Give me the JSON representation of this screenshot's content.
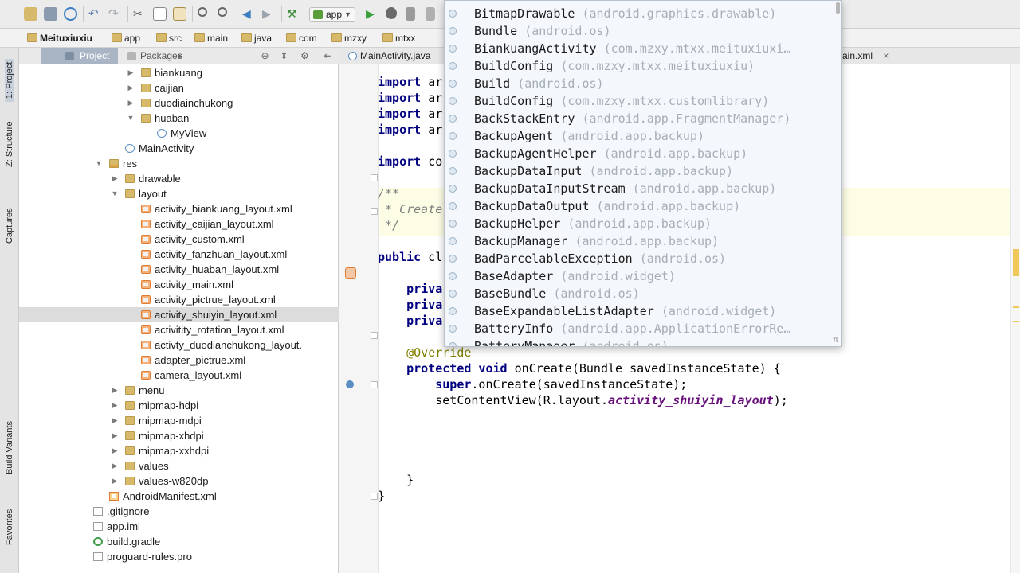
{
  "toolbar": {
    "run_config": "app"
  },
  "breadcrumb": [
    "Meituxiuxiu",
    "app",
    "src",
    "main",
    "java",
    "com",
    "mzxy",
    "mtxx"
  ],
  "left_strip": {
    "tabs": [
      "1: Project",
      "Z: Structure",
      "Captures",
      "Build Variants",
      "Favorites"
    ]
  },
  "project_panel": {
    "tabs": [
      "Project",
      "Packages"
    ],
    "tree": [
      {
        "label": "biankuang",
        "type": "folder",
        "depth": 3,
        "expanded": false
      },
      {
        "label": "caijian",
        "type": "folder",
        "depth": 3,
        "expanded": false
      },
      {
        "label": "duodiainchukong",
        "type": "folder",
        "depth": 3,
        "expanded": false
      },
      {
        "label": "huaban",
        "type": "folder",
        "depth": 3,
        "expanded": true
      },
      {
        "label": "MyView",
        "type": "class",
        "depth": 4
      },
      {
        "label": "MainActivity",
        "type": "class",
        "depth": 2
      },
      {
        "label": "res",
        "type": "res",
        "depth": 1,
        "expanded": true
      },
      {
        "label": "drawable",
        "type": "folder",
        "depth": 2,
        "expanded": false
      },
      {
        "label": "layout",
        "type": "folder",
        "depth": 2,
        "expanded": true
      },
      {
        "label": "activity_biankuang_layout.xml",
        "type": "xml",
        "depth": 3
      },
      {
        "label": "activity_caijian_layout.xml",
        "type": "xml",
        "depth": 3
      },
      {
        "label": "activity_custom.xml",
        "type": "xml",
        "depth": 3
      },
      {
        "label": "activity_fanzhuan_layout.xml",
        "type": "xml",
        "depth": 3
      },
      {
        "label": "activity_huaban_layout.xml",
        "type": "xml",
        "depth": 3
      },
      {
        "label": "activity_main.xml",
        "type": "xml",
        "depth": 3
      },
      {
        "label": "activity_pictrue_layout.xml",
        "type": "xml",
        "depth": 3
      },
      {
        "label": "activity_shuiyin_layout.xml",
        "type": "xml",
        "depth": 3,
        "selected": true
      },
      {
        "label": "activitity_rotation_layout.xml",
        "type": "xml",
        "depth": 3
      },
      {
        "label": "activty_duodianchukong_layout.",
        "type": "xml",
        "depth": 3
      },
      {
        "label": "adapter_pictrue.xml",
        "type": "xml",
        "depth": 3
      },
      {
        "label": "camera_layout.xml",
        "type": "xml",
        "depth": 3
      },
      {
        "label": "menu",
        "type": "folder",
        "depth": 2,
        "expanded": false
      },
      {
        "label": "mipmap-hdpi",
        "type": "folder",
        "depth": 2,
        "expanded": false
      },
      {
        "label": "mipmap-mdpi",
        "type": "folder",
        "depth": 2,
        "expanded": false
      },
      {
        "label": "mipmap-xhdpi",
        "type": "folder",
        "depth": 2,
        "expanded": false
      },
      {
        "label": "mipmap-xxhdpi",
        "type": "folder",
        "depth": 2,
        "expanded": false
      },
      {
        "label": "values",
        "type": "folder",
        "depth": 2,
        "expanded": false
      },
      {
        "label": "values-w820dp",
        "type": "folder",
        "depth": 2,
        "expanded": false
      },
      {
        "label": "AndroidManifest.xml",
        "type": "manifest",
        "depth": 1
      },
      {
        "label": ".gitignore",
        "type": "file",
        "depth": 0
      },
      {
        "label": "app.iml",
        "type": "file",
        "depth": 0
      },
      {
        "label": "build.gradle",
        "type": "gradle",
        "depth": 0
      },
      {
        "label": "proguard-rules.pro",
        "type": "file",
        "depth": 0
      }
    ]
  },
  "editor": {
    "tabs": [
      "MainActivity.java",
      "ain.xml"
    ],
    "code": [
      [
        {
          "t": "import",
          "c": "kw"
        },
        {
          "t": " ar"
        }
      ],
      [
        {
          "t": "import",
          "c": "kw"
        },
        {
          "t": " ar"
        }
      ],
      [
        {
          "t": "import",
          "c": "kw"
        },
        {
          "t": " ar"
        }
      ],
      [
        {
          "t": "import",
          "c": "kw"
        },
        {
          "t": " ar"
        }
      ],
      [],
      [
        {
          "t": "import",
          "c": "kw"
        },
        {
          "t": " co"
        }
      ],
      [],
      [
        {
          "t": "/**",
          "c": "cm"
        }
      ],
      [
        {
          "t": " * Create",
          "c": "cm"
        }
      ],
      [
        {
          "t": " */",
          "c": "cm"
        }
      ],
      [],
      [
        {
          "t": "public",
          "c": "kw"
        },
        {
          "t": " cl"
        }
      ],
      [],
      [
        {
          "t": "    "
        },
        {
          "t": "priva",
          "c": "kw"
        }
      ],
      [
        {
          "t": "    "
        },
        {
          "t": "priva",
          "c": "kw"
        }
      ],
      [
        {
          "t": "    "
        },
        {
          "t": "priva",
          "c": "kw"
        }
      ],
      [],
      [
        {
          "t": "    "
        },
        {
          "t": "@Override",
          "c": "an"
        }
      ],
      [
        {
          "t": "    "
        },
        {
          "t": "protected void",
          "c": "kw"
        },
        {
          "t": " onCreate(Bundle savedInstanceState) {"
        }
      ],
      [
        {
          "t": "        "
        },
        {
          "t": "super",
          "c": "kw"
        },
        {
          "t": ".onCreate(savedInstanceState);"
        }
      ],
      [
        {
          "t": "        setContentView(R.layout."
        },
        {
          "t": "activity_shuiyin_layout",
          "c": "it"
        },
        {
          "t": ");"
        }
      ],
      [],
      [],
      [],
      [],
      [
        {
          "t": "    }"
        }
      ],
      [
        {
          "t": "}"
        }
      ]
    ]
  },
  "completion": {
    "items": [
      {
        "name": "BitmapDrawable",
        "pkg": "(android.graphics.drawable)"
      },
      {
        "name": "Bundle",
        "pkg": "(android.os)"
      },
      {
        "name": "BiankuangActivity",
        "pkg": "(com.mzxy.mtxx.meituxiuxi…"
      },
      {
        "name": "BuildConfig",
        "pkg": "(com.mzxy.mtxx.meituxiuxiu)"
      },
      {
        "name": "Build",
        "pkg": "(android.os)"
      },
      {
        "name": "BuildConfig",
        "pkg": "(com.mzxy.mtxx.customlibrary)"
      },
      {
        "name": "BackStackEntry",
        "pkg": "(android.app.FragmentManager)"
      },
      {
        "name": "BackupAgent",
        "pkg": "(android.app.backup)"
      },
      {
        "name": "BackupAgentHelper",
        "pkg": "(android.app.backup)"
      },
      {
        "name": "BackupDataInput",
        "pkg": "(android.app.backup)"
      },
      {
        "name": "BackupDataInputStream",
        "pkg": "(android.app.backup)"
      },
      {
        "name": "BackupDataOutput",
        "pkg": "(android.app.backup)"
      },
      {
        "name": "BackupHelper",
        "pkg": "(android.app.backup)"
      },
      {
        "name": "BackupManager",
        "pkg": "(android.app.backup)"
      },
      {
        "name": "BadParcelableException",
        "pkg": "(android.os)"
      },
      {
        "name": "BaseAdapter",
        "pkg": "(android.widget)"
      },
      {
        "name": "BaseBundle",
        "pkg": "(android.os)"
      },
      {
        "name": "BaseExpandableListAdapter",
        "pkg": "(android.widget)"
      },
      {
        "name": "BatteryInfo",
        "pkg": "(android.app.ApplicationErrorRe…"
      },
      {
        "name": "BatteryManager",
        "pkg": "(android.os)"
      }
    ],
    "footer_glyph": "π"
  }
}
